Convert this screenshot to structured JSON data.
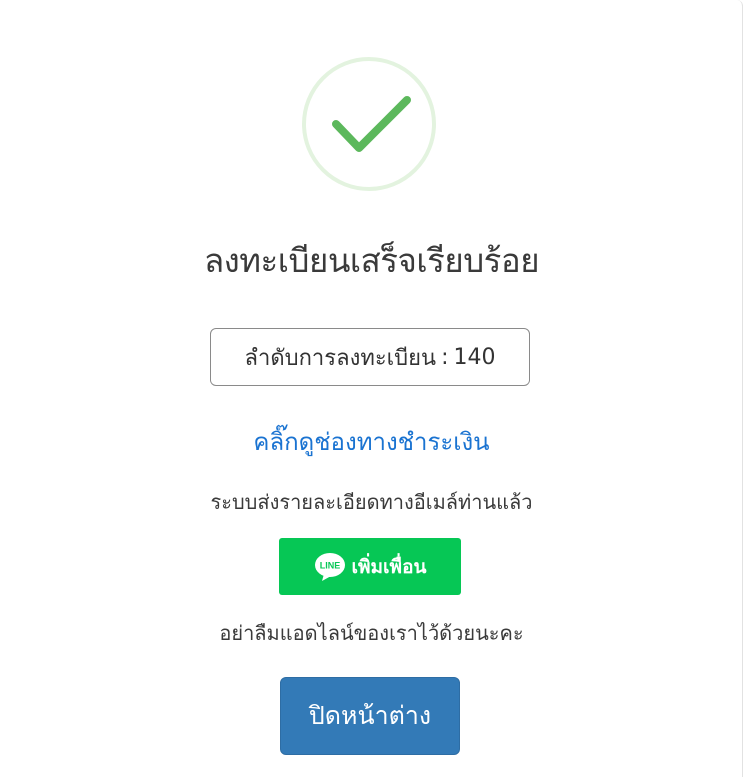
{
  "dialog": {
    "icon": "success-check-icon",
    "title": "ลงทะเบียนเสร็จเรียบร้อย",
    "registration": {
      "label": "ลำดับการลงทะเบียน",
      "separator": ":",
      "number": "140"
    },
    "payment_link": "คลิ๊กดูช่องทางชำระเงิน",
    "email_note": "ระบบส่งรายละเอียดทางอีเมล์ท่านแล้ว",
    "line_button": {
      "icon": "line-logo-icon",
      "logo_text": "LINE",
      "label": "เพิ่มเพื่อน"
    },
    "line_reminder": "อย่าลืมแอดไลน์ของเราไว้ด้วยนะคะ",
    "close_button": "ปิดหน้าต่าง"
  },
  "colors": {
    "success_green": "#5cb85c",
    "success_ring": "#e3f3df",
    "link_blue": "#1a73d1",
    "line_green": "#06c755",
    "primary_blue": "#337ab7"
  }
}
